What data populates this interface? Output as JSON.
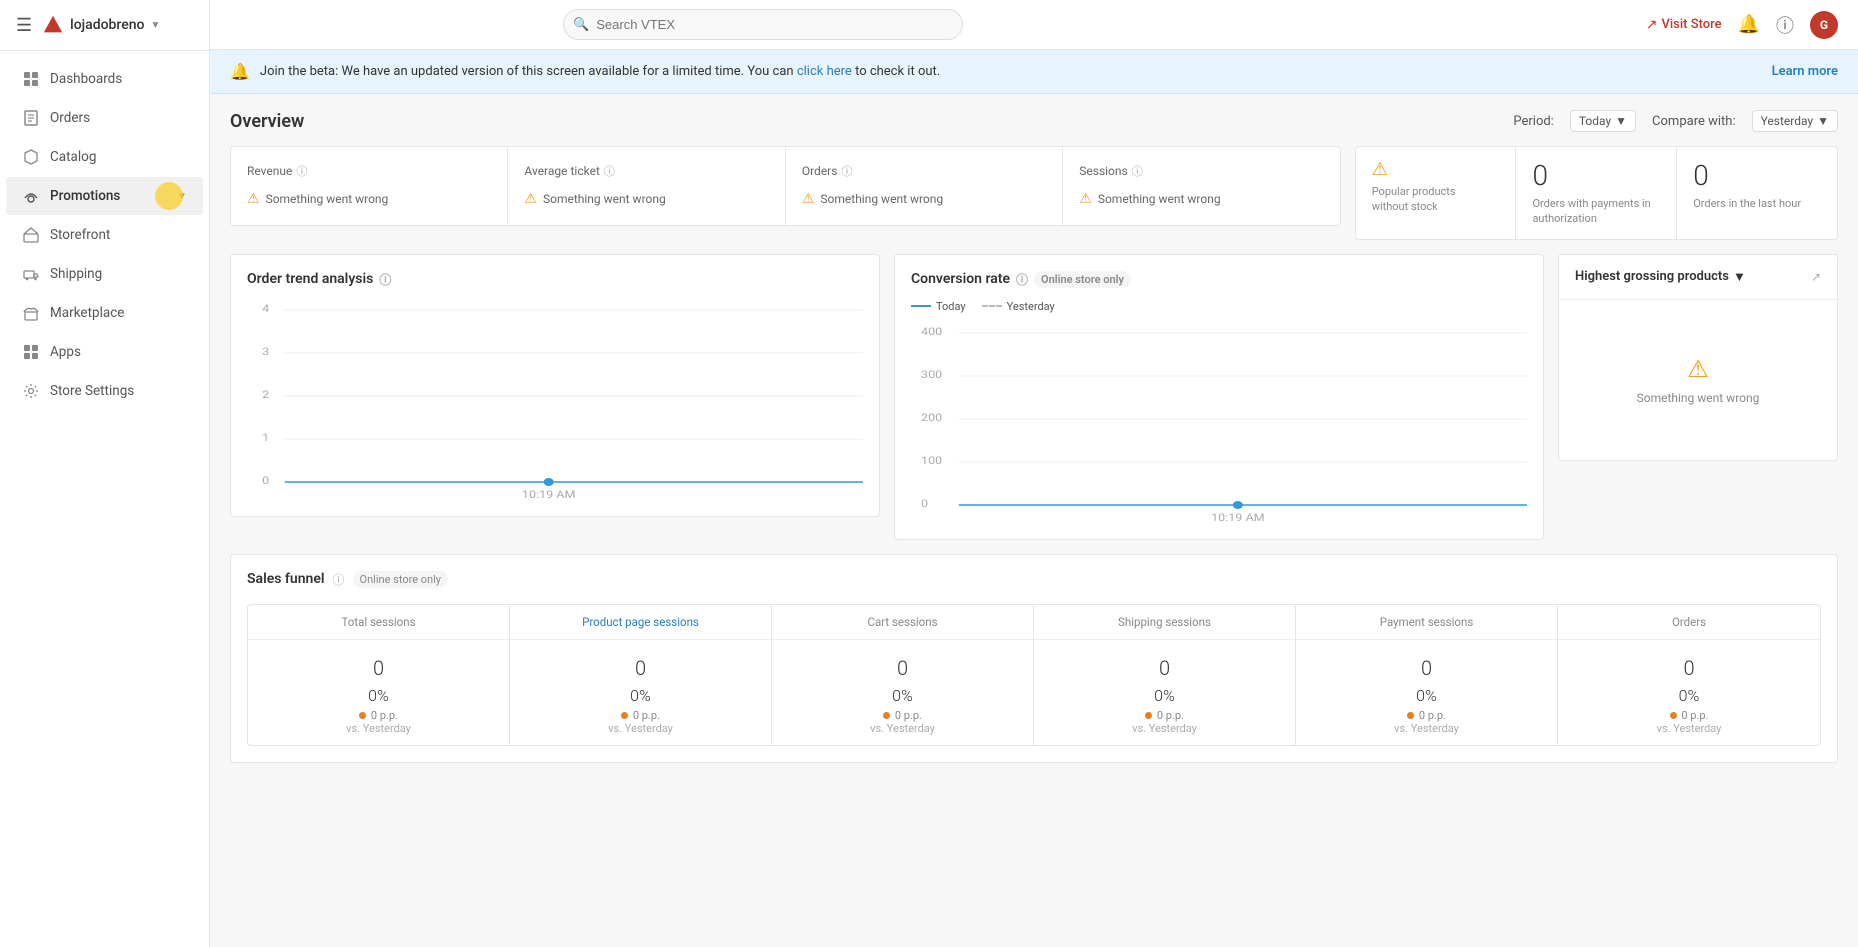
{
  "topbar": {
    "search_placeholder": "Search VTEX",
    "visit_store_label": "Visit Store",
    "store_name": "lojadobreno",
    "avatar_initial": "G"
  },
  "sidebar": {
    "items": [
      {
        "id": "dashboards",
        "label": "Dashboards",
        "icon": "grid"
      },
      {
        "id": "orders",
        "label": "Orders",
        "icon": "shopping-bag"
      },
      {
        "id": "catalog",
        "label": "Catalog",
        "icon": "tag"
      },
      {
        "id": "promotions",
        "label": "Promotions",
        "icon": "megaphone",
        "has_expand": true,
        "active": true
      },
      {
        "id": "storefront",
        "label": "Storefront",
        "icon": "layout"
      },
      {
        "id": "shipping",
        "label": "Shipping",
        "icon": "truck"
      },
      {
        "id": "marketplace",
        "label": "Marketplace",
        "icon": "store"
      },
      {
        "id": "apps",
        "label": "Apps",
        "icon": "grid-apps"
      },
      {
        "id": "store-settings",
        "label": "Store Settings",
        "icon": "settings"
      }
    ]
  },
  "beta_banner": {
    "text": "Join the beta: We have an updated version of this screen available for a limited time. You can",
    "link_text": "click here",
    "text_after": "to check it out.",
    "learn_more": "Learn more"
  },
  "overview": {
    "title": "Overview",
    "period_label": "Period:",
    "period_value": "Today",
    "compare_label": "Compare with:",
    "compare_value": "Yesterday"
  },
  "metrics": [
    {
      "id": "revenue",
      "title": "Revenue",
      "error": "Something went wrong"
    },
    {
      "id": "average-ticket",
      "title": "Average ticket",
      "error": "Something went wrong"
    },
    {
      "id": "orders",
      "title": "Orders",
      "error": "Something went wrong"
    },
    {
      "id": "sessions",
      "title": "Sessions",
      "error": "Something went wrong"
    }
  ],
  "special_metrics": [
    {
      "id": "popular-products",
      "label": "Popular products without stock",
      "value": null,
      "has_warning": true
    },
    {
      "id": "orders-payment",
      "label": "Orders with payments in authorization",
      "value": "0"
    },
    {
      "id": "orders-last-hour",
      "label": "Orders in the last hour",
      "value": "0"
    }
  ],
  "order_trend": {
    "title": "Order trend analysis",
    "y_labels": [
      "4",
      "3",
      "2",
      "1",
      "0"
    ],
    "x_label": "10:19 AM",
    "time": "10:19 AM"
  },
  "conversion_rate": {
    "title": "Conversion rate",
    "subtitle": "Online store only",
    "legend_today": "Today",
    "legend_yesterday": "Yesterday",
    "y_labels": [
      "400",
      "300",
      "200",
      "100",
      "0"
    ],
    "x_label": "10:19 AM",
    "time": "10:19 AM"
  },
  "highest_grossing": {
    "title": "Highest grossing products",
    "error": "Something went wrong"
  },
  "sales_funnel": {
    "title": "Sales funnel",
    "subtitle": "Online store only",
    "columns": [
      {
        "id": "total-sessions",
        "label": "Total sessions",
        "is_link": false,
        "value": "0",
        "percent": "0%",
        "pp": "0 p.p.",
        "vs": "vs. Yesterday"
      },
      {
        "id": "product-sessions",
        "label": "Product page sessions",
        "is_link": true,
        "value": "0",
        "percent": "0%",
        "pp": "0 p.p.",
        "vs": "vs. Yesterday"
      },
      {
        "id": "cart-sessions",
        "label": "Cart sessions",
        "is_link": false,
        "value": "0",
        "percent": "0%",
        "pp": "0 p.p.",
        "vs": "vs. Yesterday"
      },
      {
        "id": "shipping-sessions",
        "label": "Shipping sessions",
        "is_link": false,
        "value": "0",
        "percent": "0%",
        "pp": "0 p.p.",
        "vs": "vs. Yesterday"
      },
      {
        "id": "payment-sessions",
        "label": "Payment sessions",
        "is_link": false,
        "value": "0",
        "percent": "0%",
        "pp": "0 p.p.",
        "vs": "vs. Yesterday"
      },
      {
        "id": "orders-funnel",
        "label": "Orders",
        "is_link": false,
        "value": "0",
        "percent": "0%",
        "pp": "0 p.p.",
        "vs": "vs. Yesterday"
      }
    ]
  },
  "colors": {
    "vtex_red": "#c0392b",
    "blue": "#3498db",
    "warning": "#f39c12",
    "light_bg": "#f7f7f7",
    "border": "#e5e5e5",
    "error_orange": "#e67e22"
  }
}
